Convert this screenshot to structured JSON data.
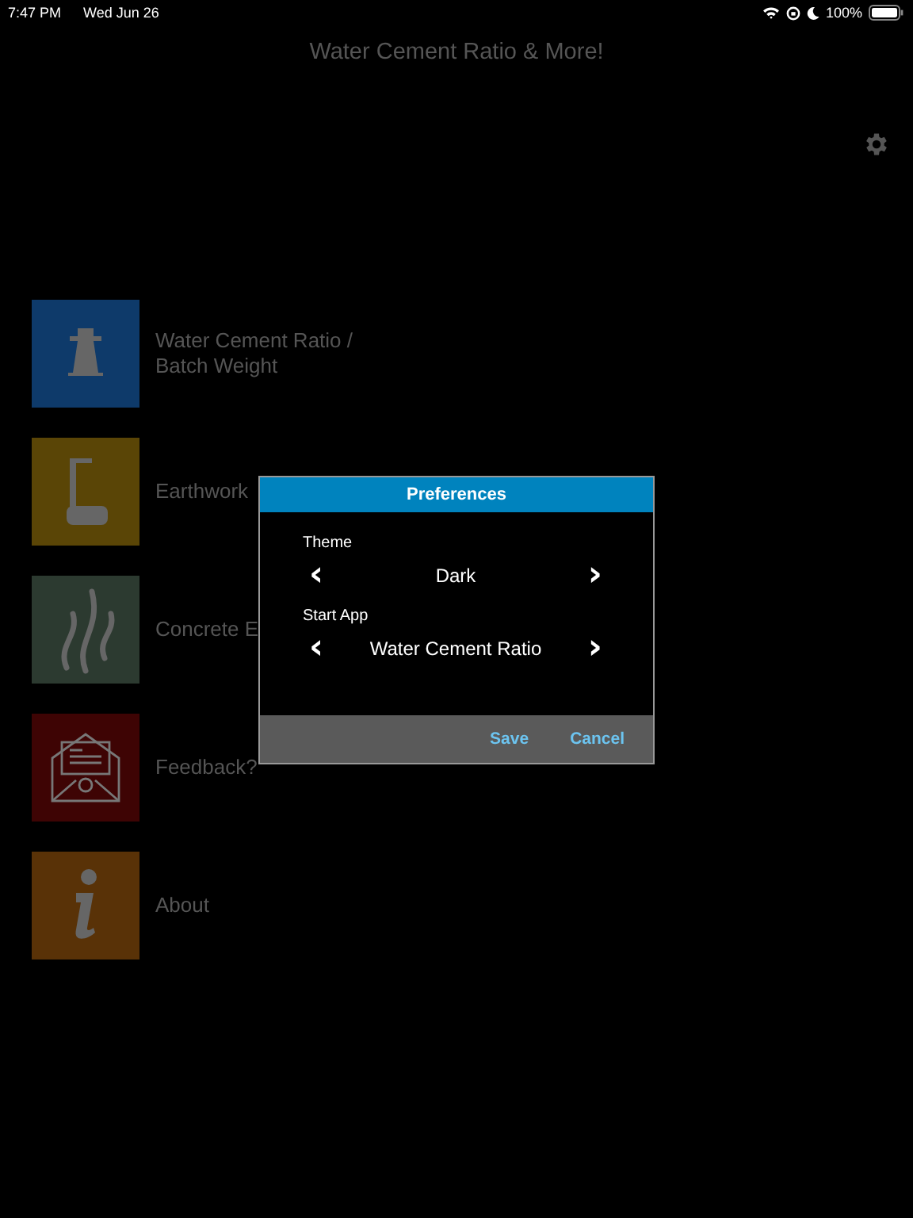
{
  "status_bar": {
    "time": "7:47 PM",
    "date": "Wed Jun 26",
    "battery": "100%"
  },
  "nav": {
    "title": "Water Cement Ratio & More!"
  },
  "menu": [
    {
      "kind": "cone",
      "label": "Water Cement Ratio /\nBatch Weight",
      "color": "#0e3a6a"
    },
    {
      "kind": "gauge",
      "label": "Earthwork",
      "color": "#5a4506"
    },
    {
      "kind": "steam",
      "label": "Concrete E",
      "color": "#2c3a30"
    },
    {
      "kind": "mail",
      "label": "Feedback?",
      "color": "#3e0404"
    },
    {
      "kind": "info",
      "label": "About",
      "color": "#593207"
    }
  ],
  "dialog": {
    "title": "Preferences",
    "settings": [
      {
        "label": "Theme",
        "value": "Dark",
        "prev": "‹",
        "next": "›"
      },
      {
        "label": "Start App",
        "value": "Water Cement Ratio",
        "prev": "‹",
        "next": "›"
      }
    ],
    "buttons": [
      "Save",
      "Cancel"
    ]
  }
}
